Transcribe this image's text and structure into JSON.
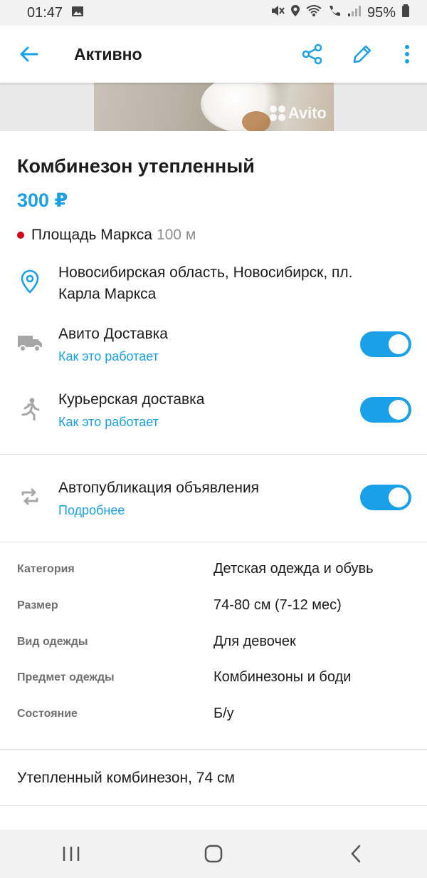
{
  "status_bar": {
    "time": "01:47",
    "battery": "95%"
  },
  "app_bar": {
    "title": "Активно"
  },
  "photo": {
    "watermark": "Avito"
  },
  "listing": {
    "title": "Комбинезон утепленный",
    "price": "300 ₽",
    "metro_station": "Площадь Маркса",
    "metro_distance": "100 м",
    "address": "Новосибирская область, Новосибирск, пл. Карла Маркса"
  },
  "delivery": [
    {
      "label": "Авито Доставка",
      "link": "Как это работает",
      "enabled": true,
      "icon": "truck-icon"
    },
    {
      "label": "Курьерская доставка",
      "link": "Как это работает",
      "enabled": true,
      "icon": "courier-icon"
    }
  ],
  "autopublish": {
    "label": "Автопубликация объявления",
    "link": "Подробнее",
    "enabled": true,
    "icon": "repeat-icon"
  },
  "params": [
    {
      "key": "Категория",
      "value": "Детская одежда и обувь"
    },
    {
      "key": "Размер",
      "value": "74-80 см (7-12 мес)"
    },
    {
      "key": "Вид одежды",
      "value": "Для девочек"
    },
    {
      "key": "Предмет одежды",
      "value": "Комбинезоны и боди"
    },
    {
      "key": "Состояние",
      "value": "Б/у"
    }
  ],
  "description": "Утепленный комбинезон, 74 см",
  "colors": {
    "accent": "#1aa0e6",
    "metro_dot": "#d0021b",
    "text": "#1c1c1c",
    "muted": "#8e8e8e"
  }
}
